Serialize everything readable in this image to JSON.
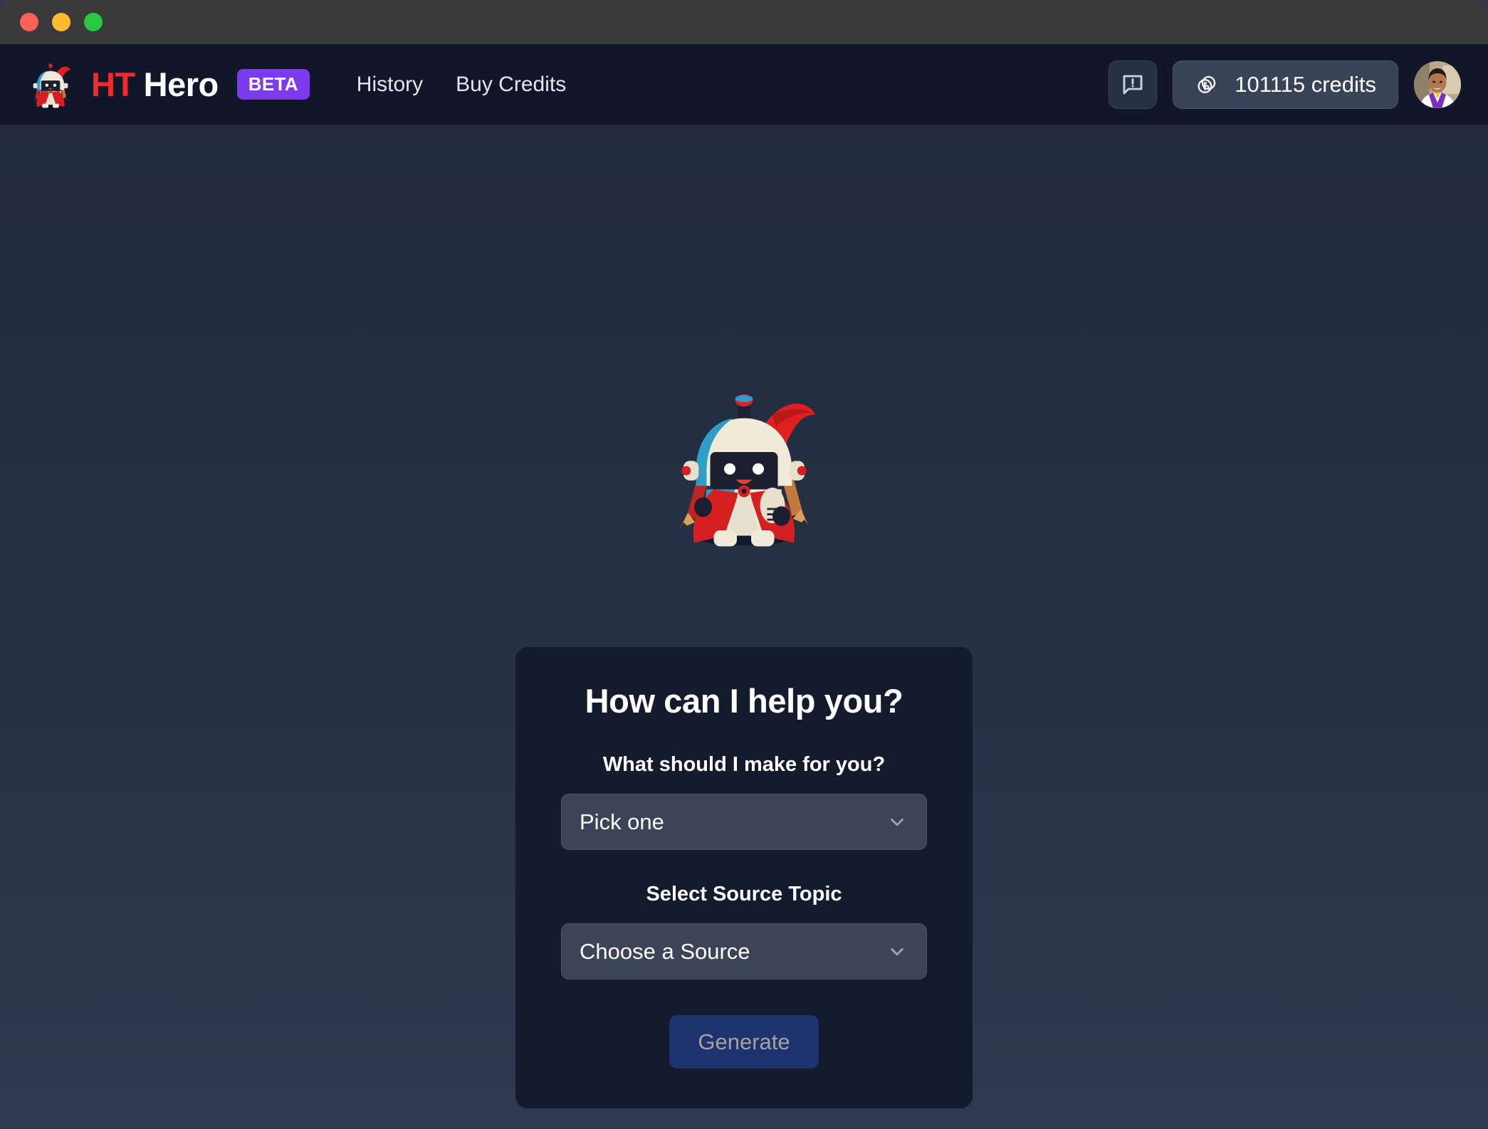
{
  "window": {
    "traffic_lights": [
      "close",
      "minimize",
      "zoom"
    ]
  },
  "header": {
    "brand": {
      "part1": "HT",
      "part2": "Hero",
      "badge": "BETA"
    },
    "nav": [
      {
        "label": "History"
      },
      {
        "label": "Buy Credits"
      }
    ],
    "feedback_icon": "speech-bubble-alert-icon",
    "credits": {
      "icon": "coins-icon",
      "label": "101115 credits",
      "amount": 101115
    },
    "avatar_alt": "user-avatar"
  },
  "main": {
    "mascot_alt": "ht-hero-robot-mascot",
    "card": {
      "title": "How can I help you?",
      "fields": [
        {
          "label": "What should I make for you?",
          "value": "Pick one",
          "chevron": "chevron-down-icon"
        },
        {
          "label": "Select Source Topic",
          "value": "Choose a Source",
          "chevron": "chevron-down-icon"
        }
      ],
      "submit_label": "Generate"
    }
  },
  "colors": {
    "titlebar": "#3a3a3a",
    "header_bg": "#111629",
    "page_bg_top": "#212b3d",
    "page_bg_bottom": "#2e3850",
    "card_bg": "#141b2d",
    "accent_red": "#ef2b2b",
    "beta_purple": "#7c3aed",
    "select_bg": "#3c4557",
    "button_bg": "#1e3270",
    "button_text": "#a3a3a3"
  }
}
